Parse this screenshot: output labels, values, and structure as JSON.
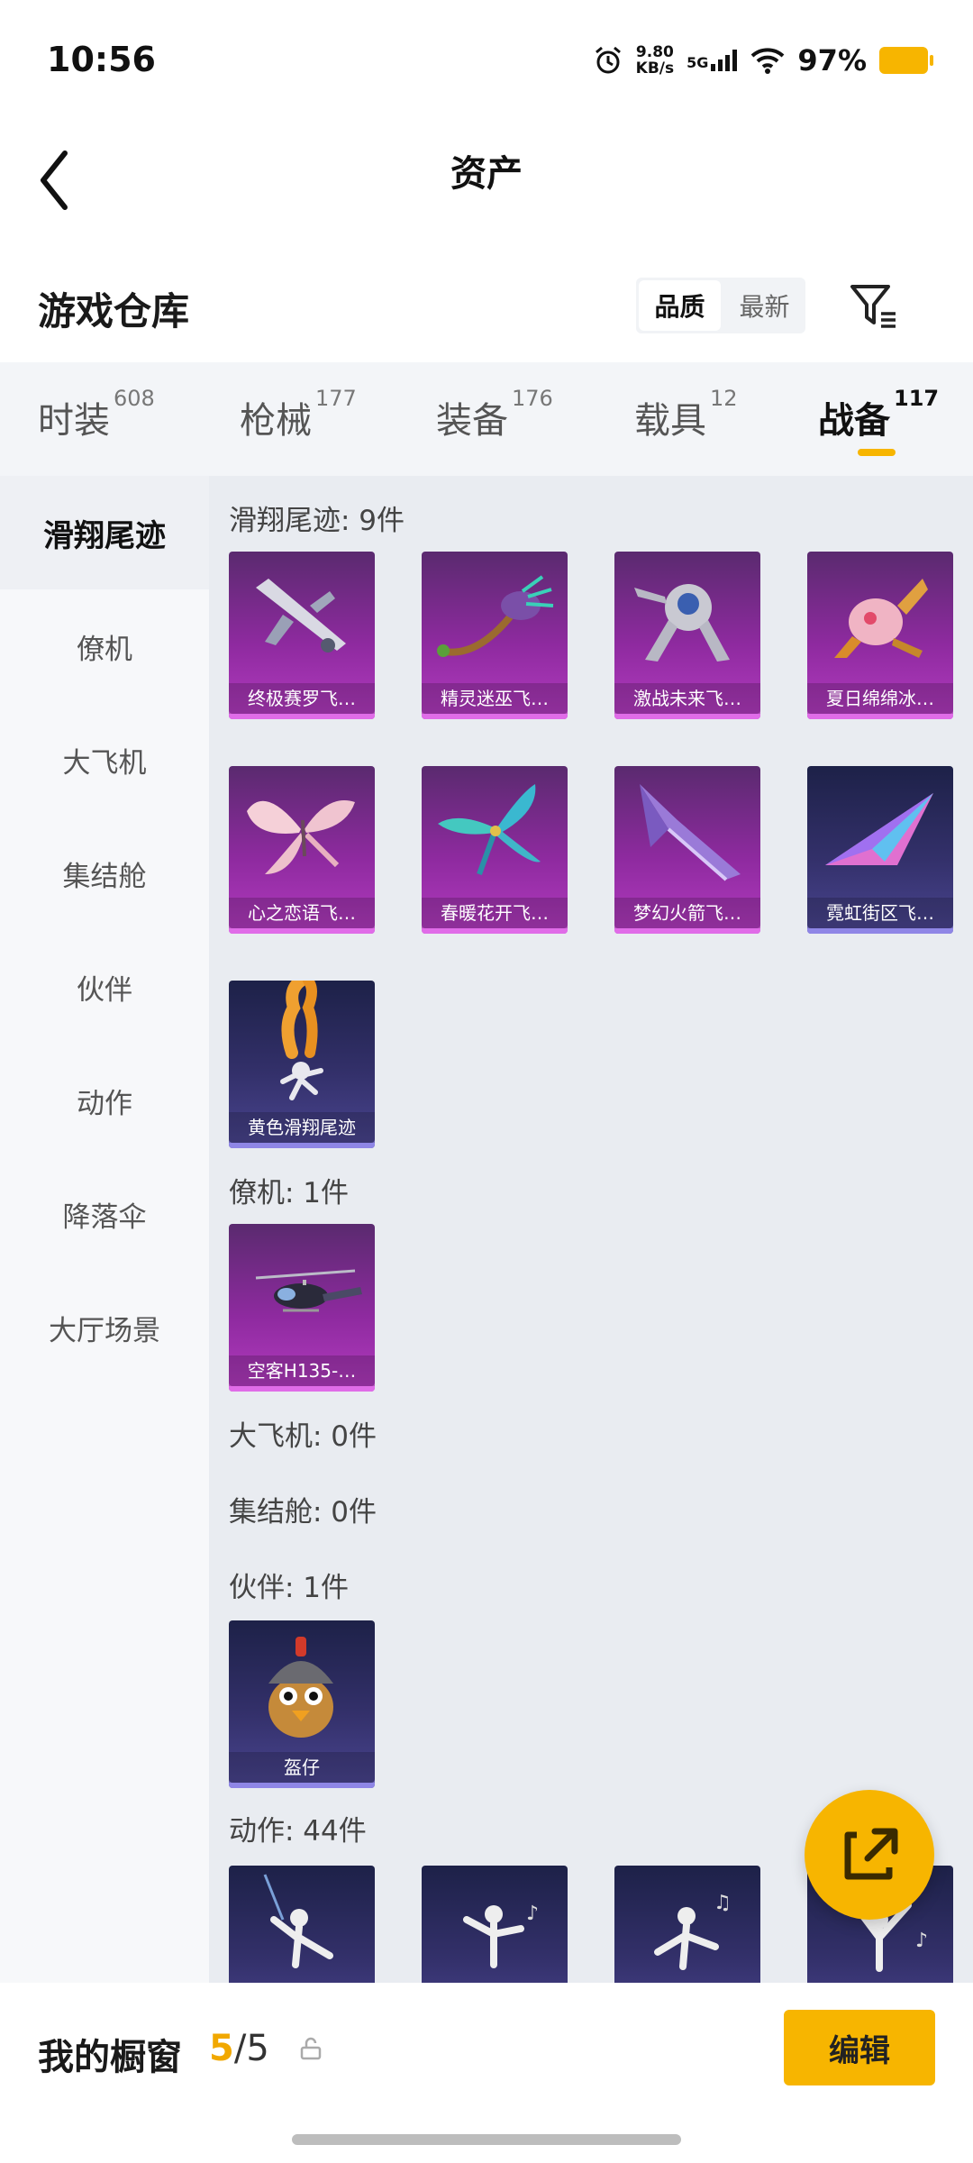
{
  "status": {
    "time": "10:56",
    "netspeed_value": "9.80",
    "netspeed_unit": "KB/s",
    "network": "5G",
    "battery_pct": "97%"
  },
  "header": {
    "title": "资产"
  },
  "warehouse": {
    "title": "游戏仓库",
    "sort_quality": "品质",
    "sort_newest": "最新"
  },
  "tabs": [
    {
      "label": "时装",
      "count": "608"
    },
    {
      "label": "枪械",
      "count": "177"
    },
    {
      "label": "装备",
      "count": "176"
    },
    {
      "label": "载具",
      "count": "12"
    },
    {
      "label": "战备",
      "count": "117"
    }
  ],
  "sidebar": [
    "滑翔尾迹",
    "僚机",
    "大飞机",
    "集结舱",
    "伙伴",
    "动作",
    "降落伞",
    "大厅场景"
  ],
  "sections": {
    "glide": "滑翔尾迹: 9件",
    "wingman": "僚机: 1件",
    "bigplane": "大飞机: 0件",
    "capsule": "集结舱: 0件",
    "partner": "伙伴: 1件",
    "emote": "动作: 44件"
  },
  "glide_items": [
    "终极赛罗飞…",
    "精灵迷巫飞…",
    "激战未来飞…",
    "夏日绵绵冰…",
    "心之恋语飞…",
    "春暖花开飞…",
    "梦幻火箭飞…",
    "霓虹街区飞…",
    "黄色滑翔尾迹"
  ],
  "wingman_items": [
    "空客H135-…"
  ],
  "partner_items": [
    "盔仔"
  ],
  "bottom": {
    "label": "我的橱窗",
    "count_current": "5",
    "count_total": "/5",
    "edit": "编辑"
  },
  "colors": {
    "accent": "#f7b500",
    "epic": "#b23bbf",
    "rare": "#4a4590"
  }
}
